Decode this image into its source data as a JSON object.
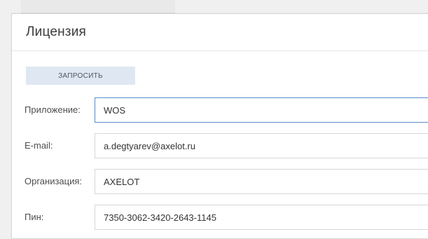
{
  "dialog": {
    "title": "Лицензия",
    "request_button_label": "ЗАПРОСИТЬ"
  },
  "form": {
    "fields": [
      {
        "label": "Приложение:",
        "value": "WOS",
        "focused": true
      },
      {
        "label": "E-mail:",
        "value": "a.degtyarev@axelot.ru",
        "focused": false
      },
      {
        "label": "Организация:",
        "value": "AXELOT",
        "focused": false
      },
      {
        "label": "Пин:",
        "value": "7350-3062-3420-2643-1145",
        "focused": false
      }
    ]
  },
  "colors": {
    "button_background": "#dfe8f2",
    "focus_border": "#5b8cc9"
  }
}
